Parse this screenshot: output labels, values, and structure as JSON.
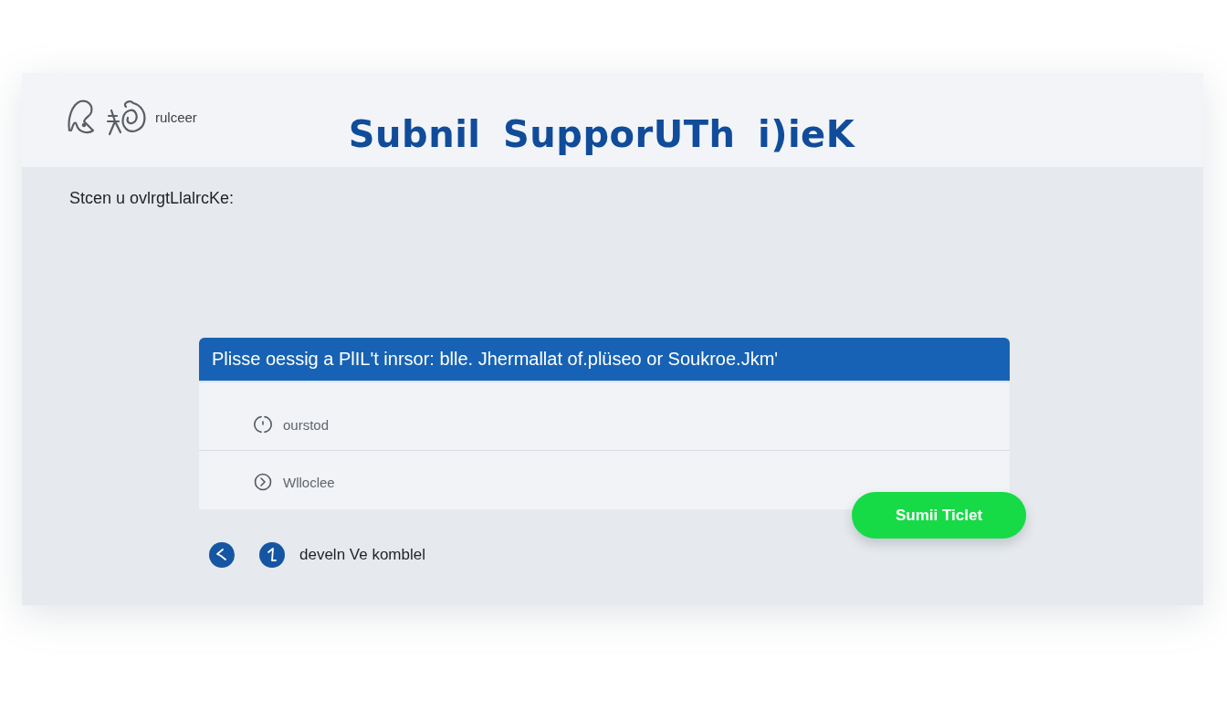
{
  "header": {
    "logo_text": "rulceer",
    "title": "Subnil SupporUTh i)ieK"
  },
  "subtitle": "Stcen u ovlrgtLlalrcKe:",
  "panel": {
    "heading": "Plisse oessig a PlIL't inrsor: blle. Jhermallat of.plüseo or Soukroe.Jkm'",
    "fields": [
      {
        "placeholder": "ourstod"
      },
      {
        "placeholder": "Wlloclee"
      }
    ]
  },
  "submit_button": {
    "label": "Sumii Ticlet"
  },
  "footer": {
    "text": "develn Ve komblel"
  }
}
